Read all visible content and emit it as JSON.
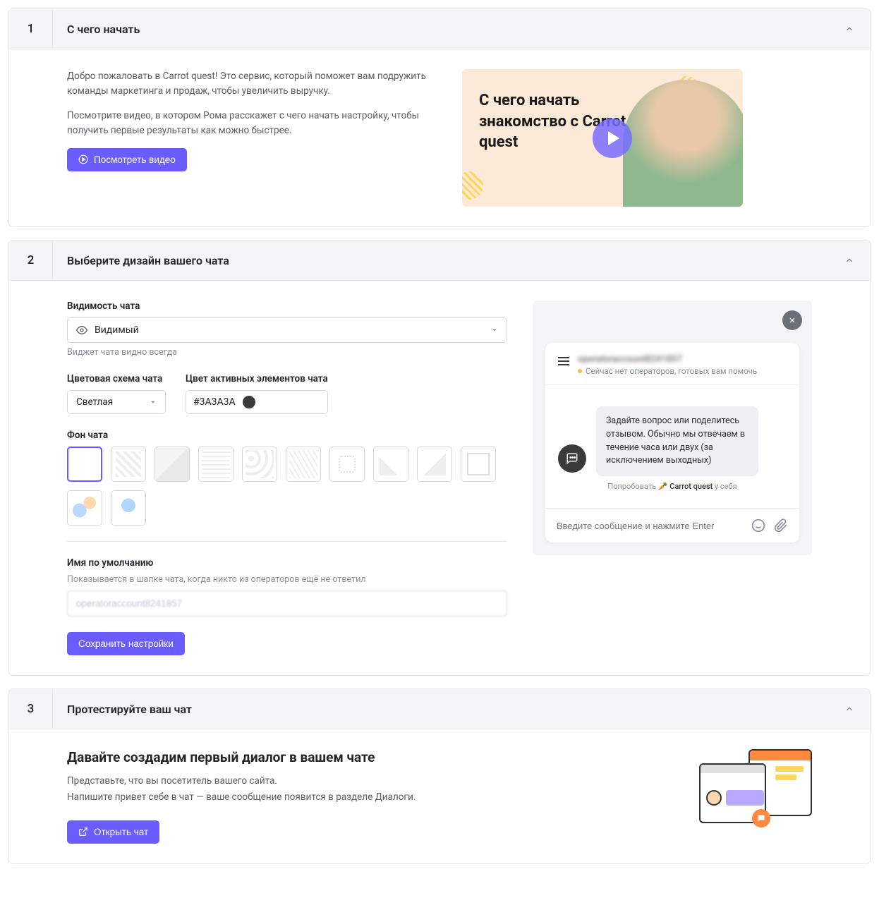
{
  "sections": [
    {
      "num": "1",
      "title": "С чего начать"
    },
    {
      "num": "2",
      "title": "Выберите дизайн вашего чата"
    },
    {
      "num": "3",
      "title": "Протестируйте ваш чат"
    }
  ],
  "s1": {
    "p1": "Добро пожаловать в Carrot quest! Это сервис, который поможет вам подружить команды маркетинга и продаж, чтобы увеличить выручку.",
    "p2": "Посмотрите видео, в котором Рома расскажет с чего начать настройку, чтобы получить первые результаты как можно быстрее.",
    "watch_btn": "Посмотреть видео",
    "thumb_text": "С чего начать знакомство с Carrot quest"
  },
  "s2": {
    "visibility_label": "Видимость чата",
    "visibility_value": "Видимый",
    "visibility_hint": "Виджет чата видно всегда",
    "scheme_label": "Цветовая схема чата",
    "scheme_value": "Светлая",
    "active_color_label": "Цвет активных элементов чата",
    "active_color_value": "#3A3A3A",
    "bg_label": "Фон чата",
    "name_label": "Имя по умолчанию",
    "name_hint": "Показывается в шапке чата, когда никто из операторов ещё не ответил",
    "save_btn": "Сохранить настройки"
  },
  "preview": {
    "status": "Сейчас нет операторов, готовых вам помочь",
    "bubble": "Задайте вопрос или поделитесь отзывом. Обычно мы отвечаем в течение часа или двух (за исключением выходных)",
    "footer_try": "Попробовать",
    "footer_brand": "Carrot quest",
    "footer_tail": "у себя",
    "input_placeholder": "Введите сообщение и нажмите Enter"
  },
  "s3": {
    "title": "Давайте создадим первый диалог в вашем чате",
    "p1": "Представьте, что вы посетитель вашего сайта.",
    "p2": "Напишите привет себе в чат — ваше сообщение появится в разделе Диалоги.",
    "open_btn": "Открыть чат"
  }
}
